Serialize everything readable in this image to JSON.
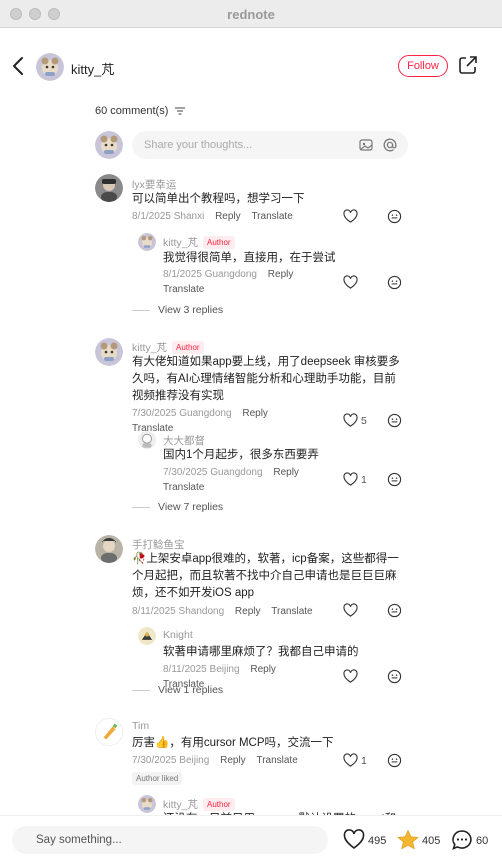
{
  "window": {
    "title": "rednote"
  },
  "header": {
    "username": "kitty_芃",
    "follow_label": "Follow"
  },
  "comments_header": {
    "count_label": "60 comment(s)"
  },
  "input": {
    "placeholder": "Share your thoughts..."
  },
  "author_badge": "Author",
  "comments": [
    {
      "name": "lyx要幸运",
      "text": "可以简单出个教程吗，想学习一下",
      "date": "8/1/2025",
      "location": "Shanxi",
      "reply_label": "Reply",
      "translate_label": "Translate",
      "reply": {
        "name": "kitty_芃",
        "text": "我觉得很简单，直接用，在于尝试",
        "date": "8/1/2025",
        "location": "Guangdong",
        "reply_label": "Reply",
        "translate_label": "Translate"
      },
      "view_replies": "View 3 replies"
    },
    {
      "name": "kitty_芃",
      "text": "有大佬知道如果app要上线，用了deepseek 审核要多久吗，有AI心理情绪智能分析和心理助手功能，目前视频推荐没有实现",
      "date": "7/30/2025",
      "location": "Guangdong",
      "reply_label": "Reply",
      "translate_label": "Translate",
      "likes": "5",
      "reply": {
        "name": "大大都督",
        "text": "国内1个月起步，很多东西要弄",
        "date": "7/30/2025",
        "location": "Guangdong",
        "reply_label": "Reply",
        "translate_label": "Translate",
        "likes": "1"
      },
      "view_replies": "View 7 replies"
    },
    {
      "name": "手打鲶鱼宝",
      "text": "🥀上架安卓app很难的，软著，icp备案，这些都得一个月起把，而且软著不找中介自己申请也是巨巨巨麻烦，还不如开发iOS app",
      "date": "8/11/2025",
      "location": "Shandong",
      "reply_label": "Reply",
      "translate_label": "Translate",
      "reply": {
        "name": "Knight",
        "text": "软著申请哪里麻烦了？我都自己申请的",
        "date": "8/11/2025",
        "location": "Beijing",
        "reply_label": "Reply",
        "translate_label": "Translate"
      },
      "view_replies": "View 1 replies"
    },
    {
      "name": "Tim",
      "text": "厉害👍，有用cursor MCP吗，交流一下",
      "date": "7/30/2025",
      "location": "Beijing",
      "reply_label": "Reply",
      "translate_label": "Translate",
      "likes": "1",
      "liked_tag": "Author liked",
      "reply": {
        "name": "kitty_芃",
        "text": "还没有，目前只用cursor，默认设置的agent和..."
      }
    }
  ],
  "bottom": {
    "placeholder": "Say something...",
    "likes": "495",
    "stars": "405",
    "comments": "60"
  },
  "colors": {
    "accent": "#ff2442",
    "star": "#f5b731"
  }
}
